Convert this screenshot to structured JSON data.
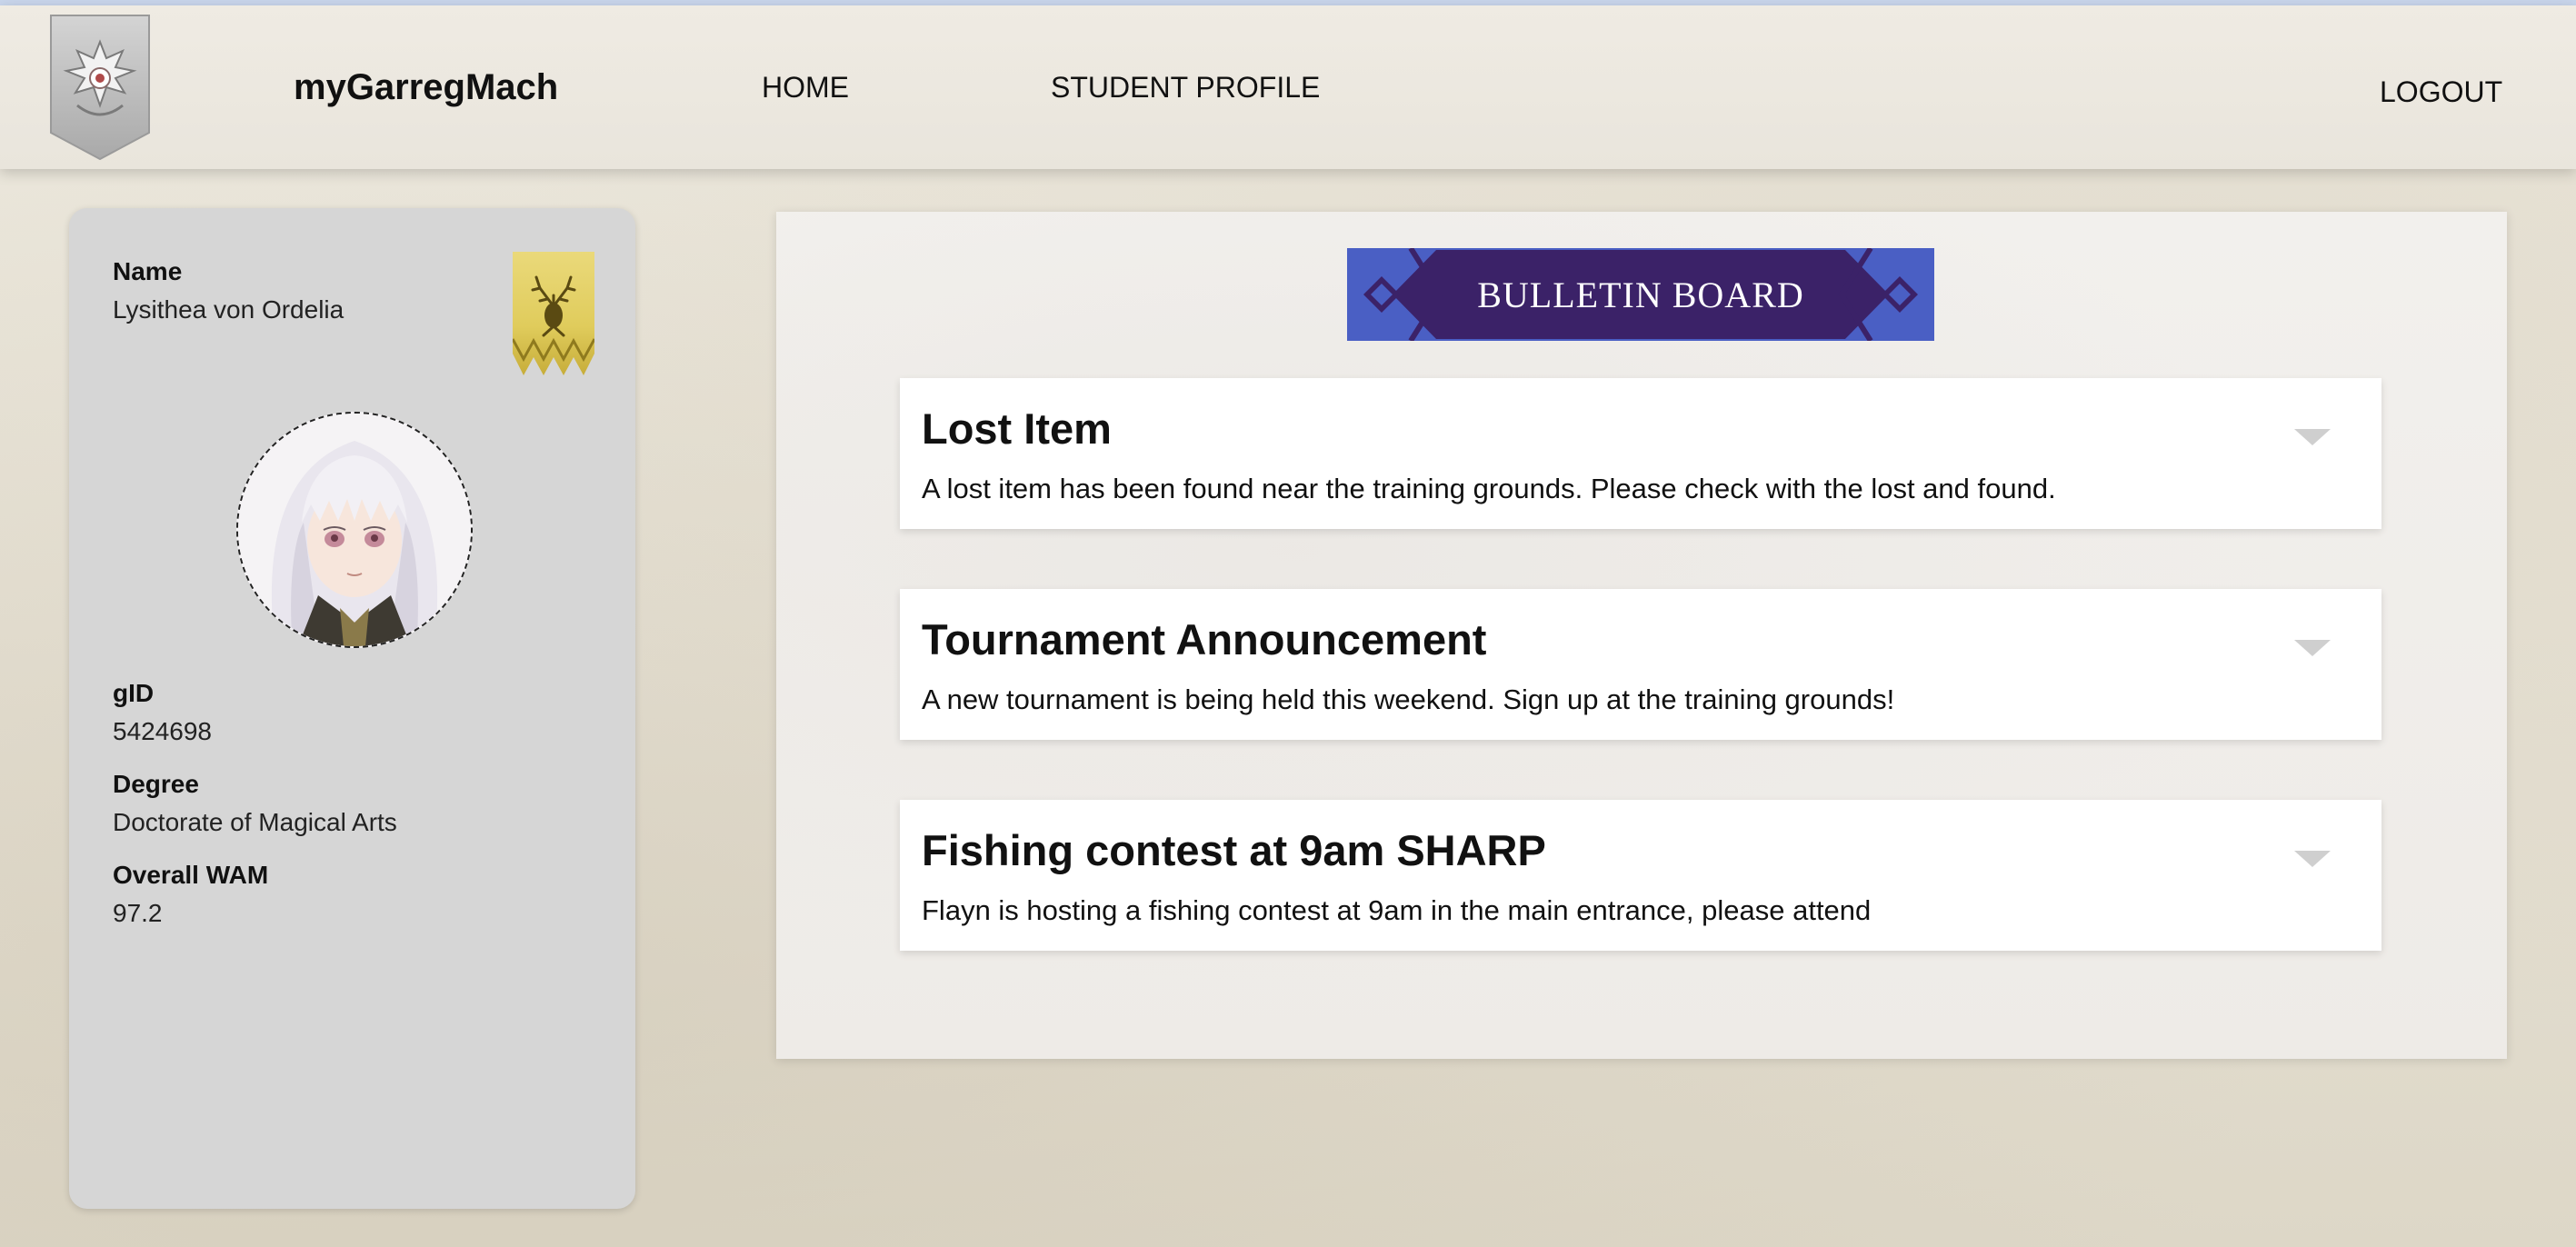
{
  "app": {
    "brand": "myGarregMach"
  },
  "nav": {
    "home": "HOME",
    "student_profile": "STUDENT PROFILE",
    "logout": "LOGOUT"
  },
  "profile": {
    "name_label": "Name",
    "name": "Lysithea von Ordelia",
    "gid_label": "gID",
    "gid": "5424698",
    "degree_label": "Degree",
    "degree": "Doctorate of Magical Arts",
    "wam_label": "Overall WAM",
    "wam": "97.2"
  },
  "bulletin": {
    "title": "BULLETIN BOARD",
    "notices": [
      {
        "title": "Lost Item",
        "body": "A lost item has been found near the training grounds. Please check with the lost and found."
      },
      {
        "title": "Tournament Announcement",
        "body": "A new tournament is being held this weekend. Sign up at the training grounds!"
      },
      {
        "title": "Fishing contest at 9am SHARP",
        "body": "Flayn is hosting a fishing contest at 9am in the main entrance, please attend"
      }
    ]
  },
  "colors": {
    "banner_purple": "#3b2268",
    "banner_accent": "#4a5fc4",
    "house_gold": "#e8d56a",
    "card_grey": "#d6d6d6"
  },
  "icons": {
    "crest": "church-of-seiros-crest-icon",
    "house": "golden-deer-banner-icon",
    "expand": "chevron-down-icon"
  }
}
